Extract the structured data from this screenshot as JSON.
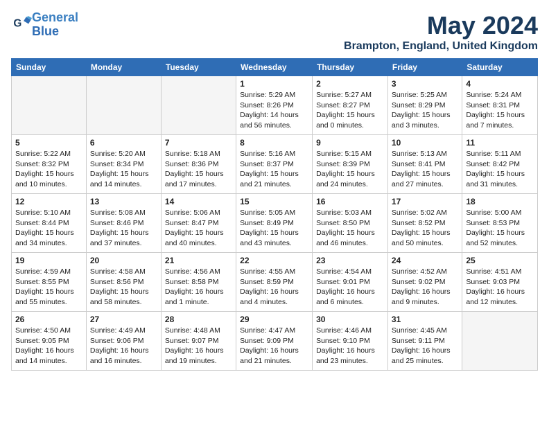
{
  "header": {
    "logo_line1": "General",
    "logo_line2": "Blue",
    "month": "May 2024",
    "location": "Brampton, England, United Kingdom"
  },
  "weekdays": [
    "Sunday",
    "Monday",
    "Tuesday",
    "Wednesday",
    "Thursday",
    "Friday",
    "Saturday"
  ],
  "weeks": [
    [
      {
        "day": "",
        "info": ""
      },
      {
        "day": "",
        "info": ""
      },
      {
        "day": "",
        "info": ""
      },
      {
        "day": "1",
        "info": "Sunrise: 5:29 AM\nSunset: 8:26 PM\nDaylight: 14 hours\nand 56 minutes."
      },
      {
        "day": "2",
        "info": "Sunrise: 5:27 AM\nSunset: 8:27 PM\nDaylight: 15 hours\nand 0 minutes."
      },
      {
        "day": "3",
        "info": "Sunrise: 5:25 AM\nSunset: 8:29 PM\nDaylight: 15 hours\nand 3 minutes."
      },
      {
        "day": "4",
        "info": "Sunrise: 5:24 AM\nSunset: 8:31 PM\nDaylight: 15 hours\nand 7 minutes."
      }
    ],
    [
      {
        "day": "5",
        "info": "Sunrise: 5:22 AM\nSunset: 8:32 PM\nDaylight: 15 hours\nand 10 minutes."
      },
      {
        "day": "6",
        "info": "Sunrise: 5:20 AM\nSunset: 8:34 PM\nDaylight: 15 hours\nand 14 minutes."
      },
      {
        "day": "7",
        "info": "Sunrise: 5:18 AM\nSunset: 8:36 PM\nDaylight: 15 hours\nand 17 minutes."
      },
      {
        "day": "8",
        "info": "Sunrise: 5:16 AM\nSunset: 8:37 PM\nDaylight: 15 hours\nand 21 minutes."
      },
      {
        "day": "9",
        "info": "Sunrise: 5:15 AM\nSunset: 8:39 PM\nDaylight: 15 hours\nand 24 minutes."
      },
      {
        "day": "10",
        "info": "Sunrise: 5:13 AM\nSunset: 8:41 PM\nDaylight: 15 hours\nand 27 minutes."
      },
      {
        "day": "11",
        "info": "Sunrise: 5:11 AM\nSunset: 8:42 PM\nDaylight: 15 hours\nand 31 minutes."
      }
    ],
    [
      {
        "day": "12",
        "info": "Sunrise: 5:10 AM\nSunset: 8:44 PM\nDaylight: 15 hours\nand 34 minutes."
      },
      {
        "day": "13",
        "info": "Sunrise: 5:08 AM\nSunset: 8:46 PM\nDaylight: 15 hours\nand 37 minutes."
      },
      {
        "day": "14",
        "info": "Sunrise: 5:06 AM\nSunset: 8:47 PM\nDaylight: 15 hours\nand 40 minutes."
      },
      {
        "day": "15",
        "info": "Sunrise: 5:05 AM\nSunset: 8:49 PM\nDaylight: 15 hours\nand 43 minutes."
      },
      {
        "day": "16",
        "info": "Sunrise: 5:03 AM\nSunset: 8:50 PM\nDaylight: 15 hours\nand 46 minutes."
      },
      {
        "day": "17",
        "info": "Sunrise: 5:02 AM\nSunset: 8:52 PM\nDaylight: 15 hours\nand 50 minutes."
      },
      {
        "day": "18",
        "info": "Sunrise: 5:00 AM\nSunset: 8:53 PM\nDaylight: 15 hours\nand 52 minutes."
      }
    ],
    [
      {
        "day": "19",
        "info": "Sunrise: 4:59 AM\nSunset: 8:55 PM\nDaylight: 15 hours\nand 55 minutes."
      },
      {
        "day": "20",
        "info": "Sunrise: 4:58 AM\nSunset: 8:56 PM\nDaylight: 15 hours\nand 58 minutes."
      },
      {
        "day": "21",
        "info": "Sunrise: 4:56 AM\nSunset: 8:58 PM\nDaylight: 16 hours\nand 1 minute."
      },
      {
        "day": "22",
        "info": "Sunrise: 4:55 AM\nSunset: 8:59 PM\nDaylight: 16 hours\nand 4 minutes."
      },
      {
        "day": "23",
        "info": "Sunrise: 4:54 AM\nSunset: 9:01 PM\nDaylight: 16 hours\nand 6 minutes."
      },
      {
        "day": "24",
        "info": "Sunrise: 4:52 AM\nSunset: 9:02 PM\nDaylight: 16 hours\nand 9 minutes."
      },
      {
        "day": "25",
        "info": "Sunrise: 4:51 AM\nSunset: 9:03 PM\nDaylight: 16 hours\nand 12 minutes."
      }
    ],
    [
      {
        "day": "26",
        "info": "Sunrise: 4:50 AM\nSunset: 9:05 PM\nDaylight: 16 hours\nand 14 minutes."
      },
      {
        "day": "27",
        "info": "Sunrise: 4:49 AM\nSunset: 9:06 PM\nDaylight: 16 hours\nand 16 minutes."
      },
      {
        "day": "28",
        "info": "Sunrise: 4:48 AM\nSunset: 9:07 PM\nDaylight: 16 hours\nand 19 minutes."
      },
      {
        "day": "29",
        "info": "Sunrise: 4:47 AM\nSunset: 9:09 PM\nDaylight: 16 hours\nand 21 minutes."
      },
      {
        "day": "30",
        "info": "Sunrise: 4:46 AM\nSunset: 9:10 PM\nDaylight: 16 hours\nand 23 minutes."
      },
      {
        "day": "31",
        "info": "Sunrise: 4:45 AM\nSunset: 9:11 PM\nDaylight: 16 hours\nand 25 minutes."
      },
      {
        "day": "",
        "info": ""
      }
    ]
  ]
}
